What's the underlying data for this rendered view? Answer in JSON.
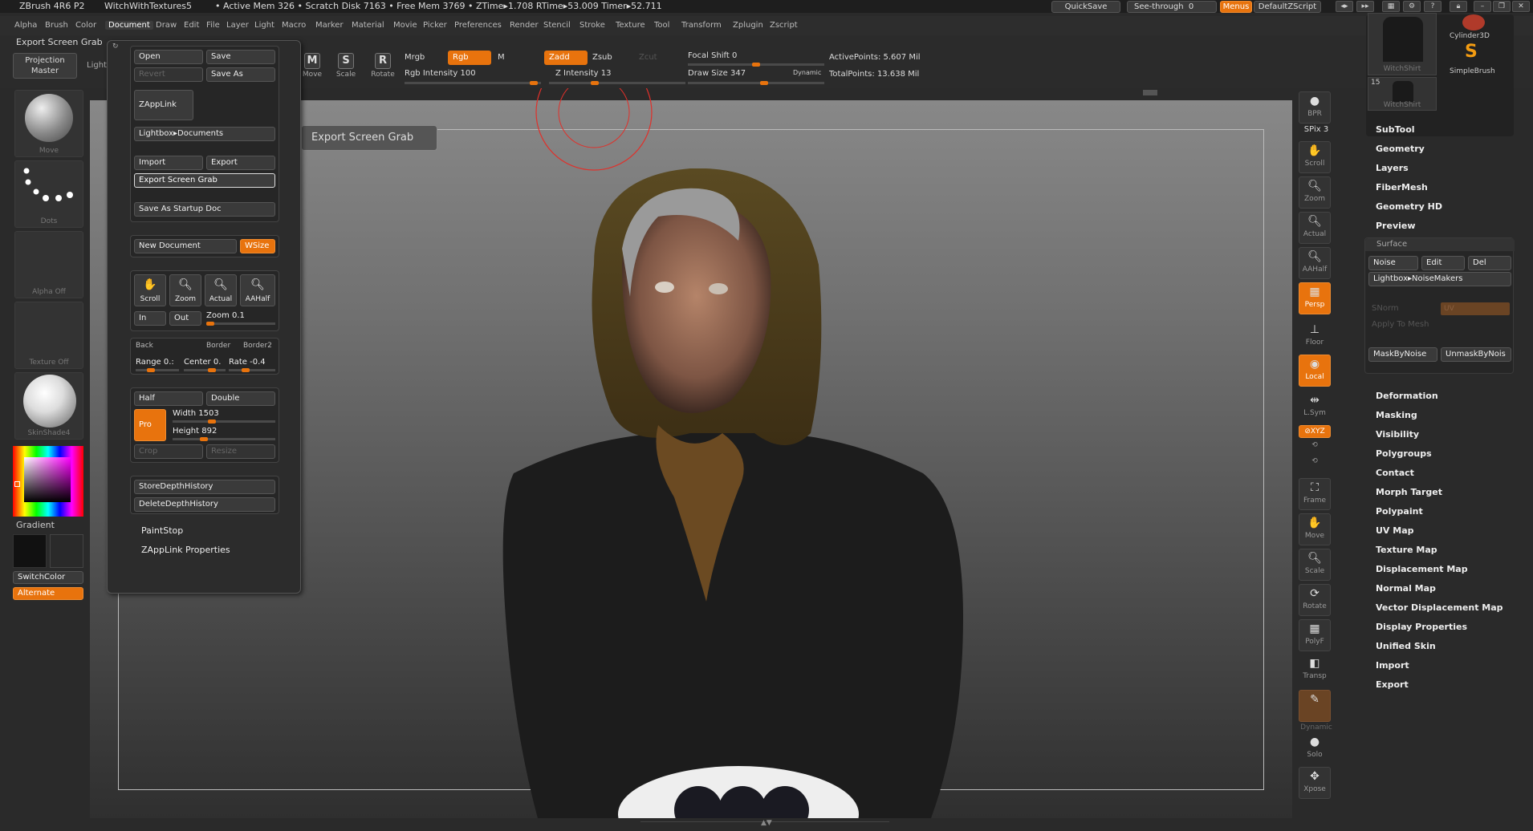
{
  "titlebar": {
    "app": "ZBrush 4R6 P2",
    "doc": "WitchWithTextures5",
    "stats": "• Active Mem 326 • Scratch Disk 7163 • Free Mem 3769 • ZTime▸1.708 RTime▸53.009 Timer▸52.711",
    "quicksave": "QuickSave",
    "seethrough": "See-through",
    "seethrough_value": "0",
    "menus": "Menus",
    "defaultzscript": "DefaultZScript"
  },
  "menubar": [
    "Alpha",
    "Brush",
    "Color",
    "Document",
    "Draw",
    "Edit",
    "File",
    "Layer",
    "Light",
    "Macro",
    "Marker",
    "Material",
    "Movie",
    "Picker",
    "Preferences",
    "Render",
    "Stencil",
    "Stroke",
    "Texture",
    "Tool",
    "Transform",
    "Zplugin",
    "Zscript"
  ],
  "toolbar": {
    "export_label": "Export Screen Grab",
    "projection_master": "Projection Master",
    "lightbox": "LightBox",
    "move": "Move",
    "scale": "Scale",
    "rotate": "Rotate",
    "mrgb": "Mrgb",
    "rgb": "Rgb",
    "m": "M",
    "rgb_intensity_label": "Rgb Intensity",
    "rgb_intensity": "100",
    "zadd": "Zadd",
    "zsub": "Zsub",
    "zcut": "Zcut",
    "z_intensity_label": "Z Intensity",
    "z_intensity": "13",
    "focal_shift_label": "Focal Shift",
    "focal_shift": "0",
    "draw_size_label": "Draw Size",
    "draw_size": "347",
    "dynamic": "Dynamic",
    "active_points": "ActivePoints: 5.607 Mil",
    "total_points": "TotalPoints: 13.638 Mil"
  },
  "leftshelf": {
    "move": "Move",
    "dots": "Dots",
    "alpha_off": "Alpha Off",
    "texture_off": "Texture Off",
    "skinshade": "SkinShade4",
    "gradient": "Gradient",
    "switchcolor": "SwitchColor",
    "alternate": "Alternate"
  },
  "docmenu": {
    "open": "Open",
    "save": "Save",
    "revert": "Revert",
    "save_as": "Save As",
    "zapplink": "ZAppLink",
    "lightbox_docs": "Lightbox▸Documents",
    "import": "Import",
    "export": "Export",
    "export_screen_grab": "Export Screen Grab",
    "save_startup": "Save As Startup Doc",
    "new_document": "New Document",
    "wsize": "WSize",
    "scroll": "Scroll",
    "zoom": "Zoom",
    "actual": "Actual",
    "aahalf": "AAHalf",
    "in": "In",
    "out": "Out",
    "zoom_value_label": "Zoom",
    "zoom_value": "0.1",
    "back": "Back",
    "border": "Border",
    "border2": "Border2",
    "range": "Range 0.:",
    "center": "Center 0.",
    "rate": "Rate -0.4",
    "half": "Half",
    "double": "Double",
    "pro": "Pro",
    "width_label": "Width",
    "width": "1503",
    "height_label": "Height",
    "height": "892",
    "crop": "Crop",
    "resize": "Resize",
    "store_depth": "StoreDepthHistory",
    "delete_depth": "DeleteDepthHistory",
    "paintstop": "PaintStop",
    "zapplink_props": "ZAppLink Properties"
  },
  "tooltip": "Export Screen Grab",
  "rightshelf": {
    "bpr": "BPR",
    "spix": "SPix 3",
    "scroll": "Scroll",
    "zoom": "Zoom",
    "actual": "Actual",
    "aahalf": "AAHalf",
    "persp": "Persp",
    "floor": "Floor",
    "local": "Local",
    "lsym": "L.Sym",
    "xyz": "⊘XYZ",
    "frame": "Frame",
    "move": "Move",
    "scale": "Scale",
    "rotate": "Rotate",
    "polyf": "PolyF",
    "transp": "Transp",
    "dynamic": "Dynamic",
    "solo": "Solo",
    "xpose": "Xpose"
  },
  "rightpal": {
    "thumb1": "WitchShirt",
    "thumb2": "WitchShirt",
    "thumb2_count": "15",
    "cylinder": "Cylinder3D",
    "simplebrush": "SimpleBrush",
    "items_top": [
      "SubTool",
      "Geometry",
      "Layers",
      "FiberMesh",
      "Geometry HD",
      "Preview"
    ],
    "surface": "Surface",
    "noise": "Noise",
    "edit": "Edit",
    "del": "Del",
    "lightbox_noise": "Lightbox▸NoiseMakers",
    "snorm": "SNorm",
    "uv": "UV",
    "apply_mesh": "Apply To Mesh",
    "mask_noise": "MaskByNoise",
    "unmask_noise": "UnmaskByNois",
    "items_bottom": [
      "Deformation",
      "Masking",
      "Visibility",
      "Polygroups",
      "Contact",
      "Morph Target",
      "Polypaint",
      "UV Map",
      "Texture Map",
      "Displacement Map",
      "Normal Map",
      "Vector Displacement Map",
      "Display Properties",
      "Unified Skin",
      "Import",
      "Export"
    ]
  },
  "colors": {
    "accent": "#e8730d",
    "panel": "#2c2c2c"
  }
}
